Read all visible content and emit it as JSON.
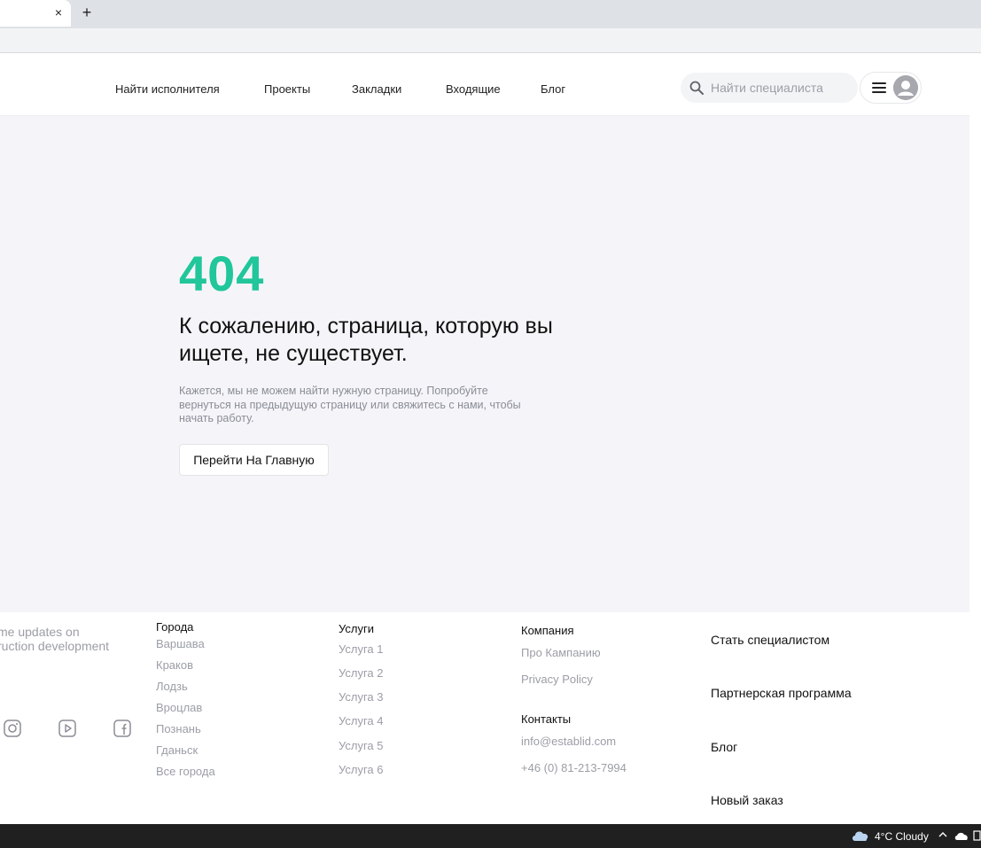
{
  "browser": {
    "tab_close": "×",
    "new_tab": "+"
  },
  "nav": {
    "items": [
      {
        "label": "Найти исполнителя"
      },
      {
        "label": "Проекты"
      },
      {
        "label": "Закладки"
      },
      {
        "label": "Входящие"
      },
      {
        "label": "Блог"
      }
    ]
  },
  "search": {
    "placeholder": "Найти специалиста",
    "value": ""
  },
  "error": {
    "code": "404",
    "title": "К сожалению, страница, которую вы ищете, не существует.",
    "description": "Кажется, мы не можем найти нужную страницу. Попробуйте вернуться на предыдущую страницу или свяжитесь с нами, чтобы начать работу.",
    "button": "Перейти На Главную"
  },
  "footer": {
    "tagline": [
      "time updates on",
      "ruction development"
    ],
    "social": [
      "instagram-icon",
      "youtube-icon",
      "facebook-icon"
    ],
    "cities": {
      "title": "Города",
      "items": [
        "Варшава",
        "Краков",
        "Лодзь",
        "Вроцлав",
        "Познань",
        "Гданьск",
        "Все города"
      ]
    },
    "services": {
      "title": "Услуги",
      "items": [
        "Услуга 1",
        "Услуга 2",
        "Услуга 3",
        "Услуга 4",
        "Услуга 5",
        "Услуга 6"
      ]
    },
    "company": {
      "title": "Компания",
      "items": [
        "Про Кампанию",
        "Privacy Policy"
      ]
    },
    "contacts": {
      "title": "Контакты",
      "email": "info@establid.com",
      "phone": "+46 (0) 81-213-7994"
    },
    "links": [
      "Стать специалистом",
      "Партнерская программа",
      "Блог",
      "Новый заказ"
    ]
  },
  "taskbar": {
    "weather": "4°C  Cloudy"
  },
  "colors": {
    "accent": "#21c69a",
    "muted": "#9b9ea6",
    "page_bg": "#f5f5f9"
  }
}
